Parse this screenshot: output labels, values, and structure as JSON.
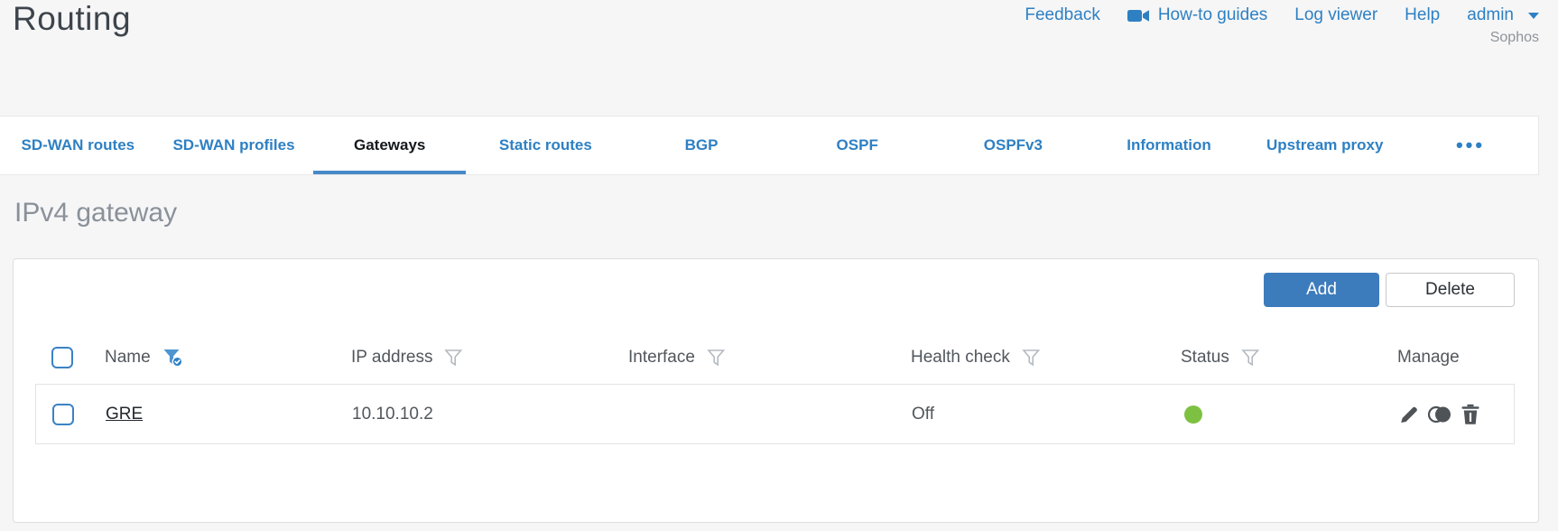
{
  "header": {
    "title": "Routing",
    "nav": {
      "feedback": "Feedback",
      "howto_guides": "How-to guides",
      "log_viewer": "Log viewer",
      "help": "Help",
      "user": "admin",
      "account": "Sophos"
    }
  },
  "tabs": {
    "items": [
      {
        "label": "SD-WAN routes",
        "active": false
      },
      {
        "label": "SD-WAN profiles",
        "active": false
      },
      {
        "label": "Gateways",
        "active": true
      },
      {
        "label": "Static routes",
        "active": false
      },
      {
        "label": "BGP",
        "active": false
      },
      {
        "label": "OSPF",
        "active": false
      },
      {
        "label": "OSPFv3",
        "active": false
      },
      {
        "label": "Information",
        "active": false
      },
      {
        "label": "Upstream proxy",
        "active": false
      }
    ],
    "more": "•••"
  },
  "section": {
    "title": "IPv4 gateway"
  },
  "toolbar": {
    "add": "Add",
    "delete": "Delete"
  },
  "table": {
    "columns": [
      {
        "label": "Name",
        "filter": "active"
      },
      {
        "label": "IP address",
        "filter": "inactive"
      },
      {
        "label": "Interface",
        "filter": "inactive"
      },
      {
        "label": "Health check",
        "filter": "inactive"
      },
      {
        "label": "Status",
        "filter": "inactive"
      },
      {
        "label": "Manage",
        "filter": "none"
      }
    ],
    "rows": [
      {
        "name": "GRE",
        "ip_address": "10.10.10.2",
        "interface": "",
        "health_check": "Off",
        "status": "green",
        "status_color": "#7ec142"
      }
    ]
  },
  "colors": {
    "accent_blue": "#2e80c3",
    "button_blue": "#3d7cbc",
    "active_tab_underline": "#4789c8",
    "status_green": "#7ec142",
    "checkbox_blue": "#3b82c4"
  }
}
